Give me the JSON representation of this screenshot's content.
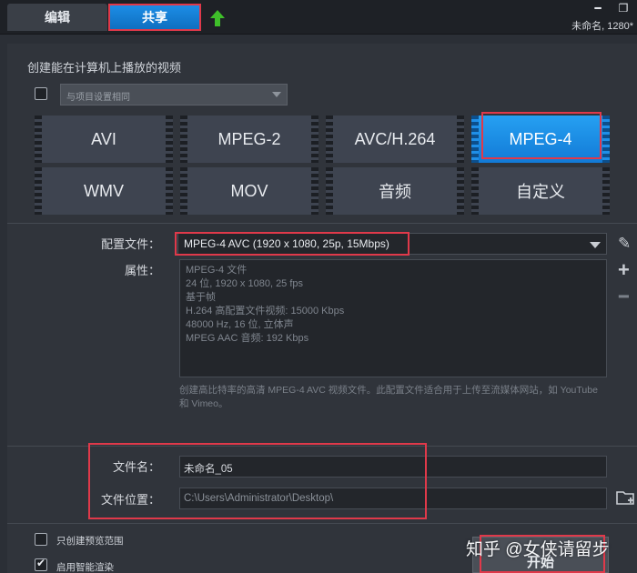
{
  "tabs": [
    {
      "label": "编辑"
    },
    {
      "label": "共享"
    }
  ],
  "window": {
    "project_name": "未命名, 1280*"
  },
  "share": {
    "section_title": "创建能在计算机上播放的视频",
    "match_project_option": "与项目设置相同",
    "formats": [
      {
        "label": "AVI"
      },
      {
        "label": "MPEG-2"
      },
      {
        "label": "AVC/H.264"
      },
      {
        "label": "MPEG-4"
      },
      {
        "label": "WMV"
      },
      {
        "label": "MOV"
      },
      {
        "label": "音频"
      },
      {
        "label": "自定义"
      }
    ],
    "selected_format": "MPEG-4",
    "profile_label": "配置文件：",
    "profile_value": "MPEG-4 AVC (1920 x 1080, 25p, 15Mbps)",
    "properties_label": "属性：",
    "properties": [
      "MPEG-4 文件",
      "24 位, 1920 x 1080, 25 fps",
      "基于帧",
      "H.264 高配置文件视频: 15000 Kbps",
      "48000 Hz, 16 位, 立体声",
      "MPEG AAC 音频: 192 Kbps"
    ],
    "description": "创建高比特率的高清 MPEG-4 AVC 视频文件。此配置文件适合用于上传至流媒体网站，如 YouTube 和 Vimeo。",
    "filename_label": "文件名：",
    "filename_value": "未命名_05",
    "location_label": "文件位置：",
    "location_value": "C:\\Users\\Administrator\\Desktop\\",
    "preview_only_label": "只创建预览范围",
    "smart_render_label": "启用智能渲染",
    "start_button": "开始"
  },
  "watermark": "知乎 @女侠请留步",
  "colors": {
    "accent": "#1c8de6",
    "highlight": "#e0394a",
    "background": "#2b2f36"
  },
  "icons": [
    "upload-arrow-icon",
    "minimize-icon",
    "restore-icon",
    "edit-pencil-icon",
    "add-icon",
    "remove-icon",
    "folder-add-icon",
    "dropdown-arrow-icon"
  ]
}
